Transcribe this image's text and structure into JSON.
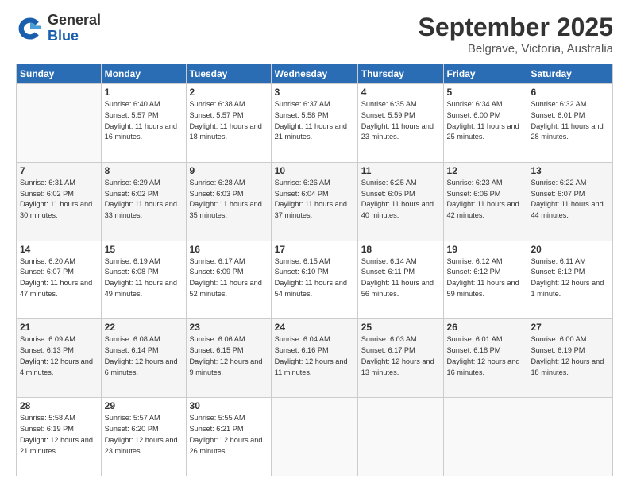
{
  "header": {
    "logo_general": "General",
    "logo_blue": "Blue",
    "month_title": "September 2025",
    "location": "Belgrave, Victoria, Australia"
  },
  "weekdays": [
    "Sunday",
    "Monday",
    "Tuesday",
    "Wednesday",
    "Thursday",
    "Friday",
    "Saturday"
  ],
  "weeks": [
    [
      {
        "day": "",
        "sunrise": "",
        "sunset": "",
        "daylight": ""
      },
      {
        "day": "1",
        "sunrise": "Sunrise: 6:40 AM",
        "sunset": "Sunset: 5:57 PM",
        "daylight": "Daylight: 11 hours and 16 minutes."
      },
      {
        "day": "2",
        "sunrise": "Sunrise: 6:38 AM",
        "sunset": "Sunset: 5:57 PM",
        "daylight": "Daylight: 11 hours and 18 minutes."
      },
      {
        "day": "3",
        "sunrise": "Sunrise: 6:37 AM",
        "sunset": "Sunset: 5:58 PM",
        "daylight": "Daylight: 11 hours and 21 minutes."
      },
      {
        "day": "4",
        "sunrise": "Sunrise: 6:35 AM",
        "sunset": "Sunset: 5:59 PM",
        "daylight": "Daylight: 11 hours and 23 minutes."
      },
      {
        "day": "5",
        "sunrise": "Sunrise: 6:34 AM",
        "sunset": "Sunset: 6:00 PM",
        "daylight": "Daylight: 11 hours and 25 minutes."
      },
      {
        "day": "6",
        "sunrise": "Sunrise: 6:32 AM",
        "sunset": "Sunset: 6:01 PM",
        "daylight": "Daylight: 11 hours and 28 minutes."
      }
    ],
    [
      {
        "day": "7",
        "sunrise": "Sunrise: 6:31 AM",
        "sunset": "Sunset: 6:02 PM",
        "daylight": "Daylight: 11 hours and 30 minutes."
      },
      {
        "day": "8",
        "sunrise": "Sunrise: 6:29 AM",
        "sunset": "Sunset: 6:02 PM",
        "daylight": "Daylight: 11 hours and 33 minutes."
      },
      {
        "day": "9",
        "sunrise": "Sunrise: 6:28 AM",
        "sunset": "Sunset: 6:03 PM",
        "daylight": "Daylight: 11 hours and 35 minutes."
      },
      {
        "day": "10",
        "sunrise": "Sunrise: 6:26 AM",
        "sunset": "Sunset: 6:04 PM",
        "daylight": "Daylight: 11 hours and 37 minutes."
      },
      {
        "day": "11",
        "sunrise": "Sunrise: 6:25 AM",
        "sunset": "Sunset: 6:05 PM",
        "daylight": "Daylight: 11 hours and 40 minutes."
      },
      {
        "day": "12",
        "sunrise": "Sunrise: 6:23 AM",
        "sunset": "Sunset: 6:06 PM",
        "daylight": "Daylight: 11 hours and 42 minutes."
      },
      {
        "day": "13",
        "sunrise": "Sunrise: 6:22 AM",
        "sunset": "Sunset: 6:07 PM",
        "daylight": "Daylight: 11 hours and 44 minutes."
      }
    ],
    [
      {
        "day": "14",
        "sunrise": "Sunrise: 6:20 AM",
        "sunset": "Sunset: 6:07 PM",
        "daylight": "Daylight: 11 hours and 47 minutes."
      },
      {
        "day": "15",
        "sunrise": "Sunrise: 6:19 AM",
        "sunset": "Sunset: 6:08 PM",
        "daylight": "Daylight: 11 hours and 49 minutes."
      },
      {
        "day": "16",
        "sunrise": "Sunrise: 6:17 AM",
        "sunset": "Sunset: 6:09 PM",
        "daylight": "Daylight: 11 hours and 52 minutes."
      },
      {
        "day": "17",
        "sunrise": "Sunrise: 6:15 AM",
        "sunset": "Sunset: 6:10 PM",
        "daylight": "Daylight: 11 hours and 54 minutes."
      },
      {
        "day": "18",
        "sunrise": "Sunrise: 6:14 AM",
        "sunset": "Sunset: 6:11 PM",
        "daylight": "Daylight: 11 hours and 56 minutes."
      },
      {
        "day": "19",
        "sunrise": "Sunrise: 6:12 AM",
        "sunset": "Sunset: 6:12 PM",
        "daylight": "Daylight: 11 hours and 59 minutes."
      },
      {
        "day": "20",
        "sunrise": "Sunrise: 6:11 AM",
        "sunset": "Sunset: 6:12 PM",
        "daylight": "Daylight: 12 hours and 1 minute."
      }
    ],
    [
      {
        "day": "21",
        "sunrise": "Sunrise: 6:09 AM",
        "sunset": "Sunset: 6:13 PM",
        "daylight": "Daylight: 12 hours and 4 minutes."
      },
      {
        "day": "22",
        "sunrise": "Sunrise: 6:08 AM",
        "sunset": "Sunset: 6:14 PM",
        "daylight": "Daylight: 12 hours and 6 minutes."
      },
      {
        "day": "23",
        "sunrise": "Sunrise: 6:06 AM",
        "sunset": "Sunset: 6:15 PM",
        "daylight": "Daylight: 12 hours and 9 minutes."
      },
      {
        "day": "24",
        "sunrise": "Sunrise: 6:04 AM",
        "sunset": "Sunset: 6:16 PM",
        "daylight": "Daylight: 12 hours and 11 minutes."
      },
      {
        "day": "25",
        "sunrise": "Sunrise: 6:03 AM",
        "sunset": "Sunset: 6:17 PM",
        "daylight": "Daylight: 12 hours and 13 minutes."
      },
      {
        "day": "26",
        "sunrise": "Sunrise: 6:01 AM",
        "sunset": "Sunset: 6:18 PM",
        "daylight": "Daylight: 12 hours and 16 minutes."
      },
      {
        "day": "27",
        "sunrise": "Sunrise: 6:00 AM",
        "sunset": "Sunset: 6:19 PM",
        "daylight": "Daylight: 12 hours and 18 minutes."
      }
    ],
    [
      {
        "day": "28",
        "sunrise": "Sunrise: 5:58 AM",
        "sunset": "Sunset: 6:19 PM",
        "daylight": "Daylight: 12 hours and 21 minutes."
      },
      {
        "day": "29",
        "sunrise": "Sunrise: 5:57 AM",
        "sunset": "Sunset: 6:20 PM",
        "daylight": "Daylight: 12 hours and 23 minutes."
      },
      {
        "day": "30",
        "sunrise": "Sunrise: 5:55 AM",
        "sunset": "Sunset: 6:21 PM",
        "daylight": "Daylight: 12 hours and 26 minutes."
      },
      {
        "day": "",
        "sunrise": "",
        "sunset": "",
        "daylight": ""
      },
      {
        "day": "",
        "sunrise": "",
        "sunset": "",
        "daylight": ""
      },
      {
        "day": "",
        "sunrise": "",
        "sunset": "",
        "daylight": ""
      },
      {
        "day": "",
        "sunrise": "",
        "sunset": "",
        "daylight": ""
      }
    ]
  ]
}
